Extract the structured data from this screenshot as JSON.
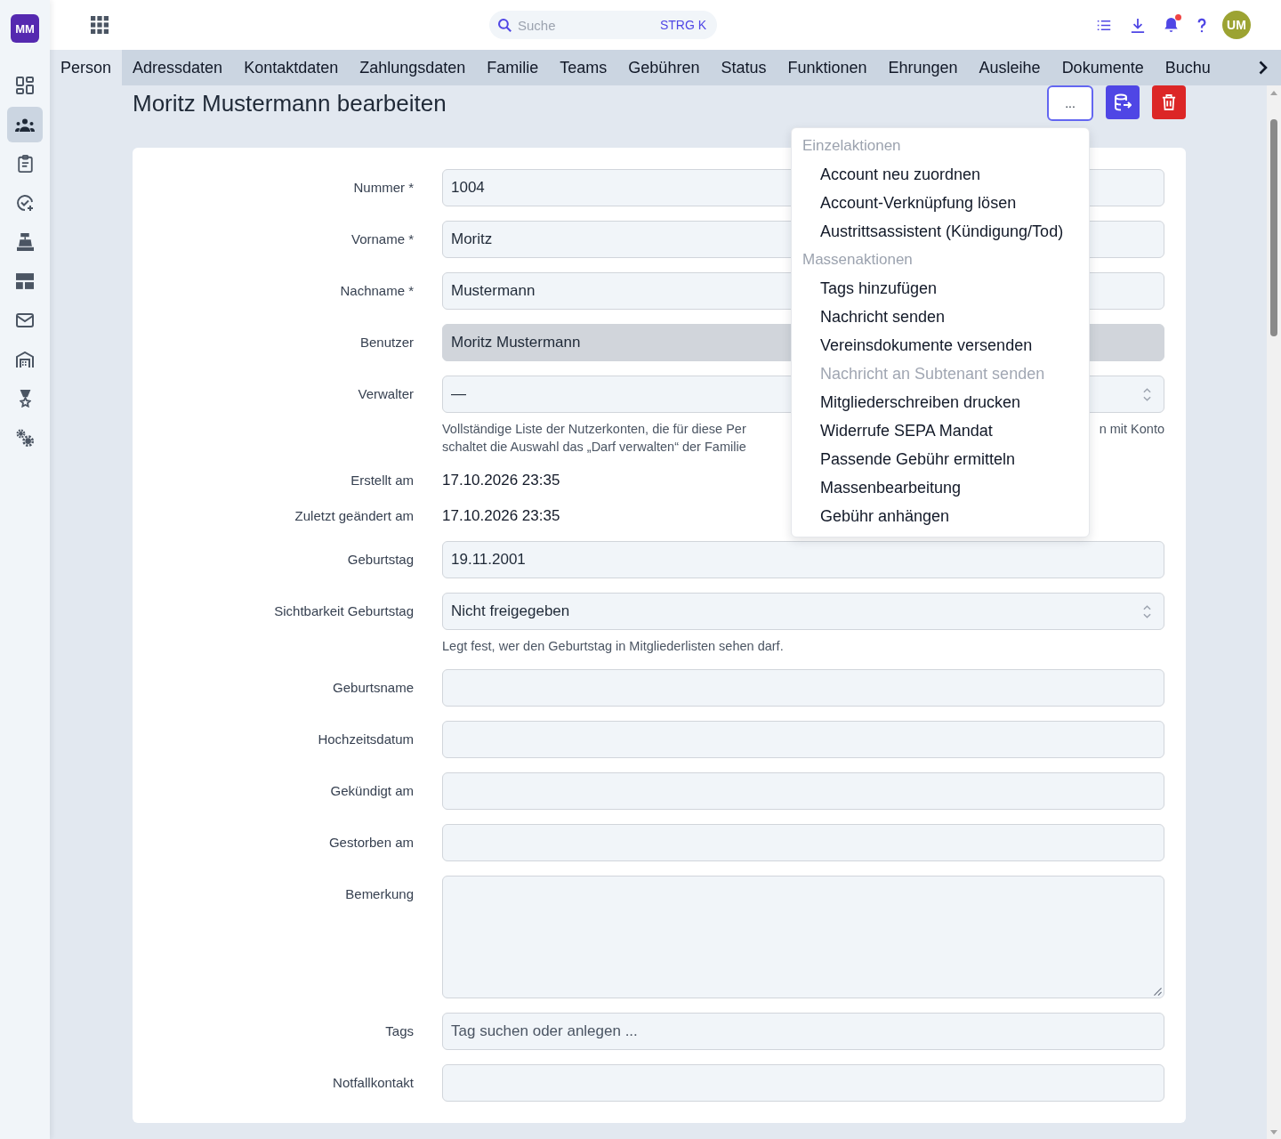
{
  "app": {
    "logo": "MM"
  },
  "sidebar": {
    "items": [
      {
        "selected": false
      },
      {
        "selected": true
      },
      {
        "selected": false
      },
      {
        "selected": false
      },
      {
        "selected": false
      },
      {
        "selected": false
      },
      {
        "selected": false
      },
      {
        "selected": false
      },
      {
        "selected": false
      },
      {
        "selected": false
      }
    ]
  },
  "header": {
    "search": {
      "placeholder": "Suche",
      "shortcut": "STRG K"
    },
    "notifications": {
      "unread": true
    },
    "avatar": {
      "initials": "UM"
    }
  },
  "tabs": [
    {
      "label": "Person",
      "selected": true
    },
    {
      "label": "Adressdaten",
      "selected": false
    },
    {
      "label": "Kontaktdaten",
      "selected": false
    },
    {
      "label": "Zahlungsdaten",
      "selected": false
    },
    {
      "label": "Familie",
      "selected": false
    },
    {
      "label": "Teams",
      "selected": false
    },
    {
      "label": "Gebühren",
      "selected": false
    },
    {
      "label": "Status",
      "selected": false
    },
    {
      "label": "Funktionen",
      "selected": false
    },
    {
      "label": "Ehrungen",
      "selected": false
    },
    {
      "label": "Ausleihe",
      "selected": false
    },
    {
      "label": "Dokumente",
      "selected": false
    },
    {
      "label": "Buchu",
      "selected": false
    }
  ],
  "page": {
    "title": "Moritz Mustermann bearbeiten",
    "more_button": "...",
    "menu": {
      "open": true,
      "sections": [
        {
          "title": "Einzelaktionen",
          "items": [
            {
              "label": "Account neu zuordnen",
              "disabled": false
            },
            {
              "label": "Account-Verknüpfung lösen",
              "disabled": false
            },
            {
              "label": "Austrittsassistent (Kündigung/Tod)",
              "disabled": false
            }
          ]
        },
        {
          "title": "Massenaktionen",
          "items": [
            {
              "label": "Tags hinzufügen",
              "disabled": false
            },
            {
              "label": "Nachricht senden",
              "disabled": false
            },
            {
              "label": "Vereinsdokumente versenden",
              "disabled": false
            },
            {
              "label": "Nachricht an Subtenant senden",
              "disabled": true
            },
            {
              "label": "Mitgliederschreiben drucken",
              "disabled": false
            },
            {
              "label": "Widerrufe SEPA Mandat",
              "disabled": false
            },
            {
              "label": "Passende Gebühr ermitteln",
              "disabled": false
            },
            {
              "label": "Massenbearbeitung",
              "disabled": false
            },
            {
              "label": "Gebühr anhängen",
              "disabled": false
            }
          ]
        }
      ]
    }
  },
  "form": {
    "fields": [
      {
        "label": "Nummer *",
        "kind": "input",
        "value": "1004",
        "disabled": false
      },
      {
        "label": "Vorname *",
        "kind": "input",
        "value": "Moritz",
        "disabled": false
      },
      {
        "label": "Nachname *",
        "kind": "input",
        "value": "Mustermann",
        "disabled": false
      },
      {
        "label": "Benutzer",
        "kind": "input",
        "value": "Moritz Mustermann",
        "disabled": true
      },
      {
        "label": "Verwalter",
        "kind": "select",
        "value": "—",
        "disabled": false,
        "help_lines": [
          {
            "left": "Vollständige Liste der Nutzerkonten, die für diese Per",
            "right": "n mit Konto"
          },
          {
            "left": "schaltet die Auswahl das „Darf verwalten“ der Familie"
          }
        ]
      },
      {
        "label": "Erstellt am",
        "kind": "static",
        "value": "17.10.2026 23:35",
        "disabled": false
      },
      {
        "label": "Zuletzt geändert am",
        "kind": "static",
        "value": "17.10.2026 23:35",
        "disabled": false
      },
      {
        "label": "Geburtstag",
        "kind": "input",
        "value": "19.11.2001",
        "disabled": false
      },
      {
        "label": "Sichtbarkeit Geburtstag",
        "kind": "select",
        "value": "Nicht freigegeben",
        "disabled": false,
        "help_lines": [
          {
            "left": "Legt fest, wer den Geburtstag in Mitgliederlisten sehen darf."
          }
        ]
      },
      {
        "label": "Geburtsname",
        "kind": "input",
        "disabled": false
      },
      {
        "label": "Hochzeitsdatum",
        "kind": "input",
        "disabled": false
      },
      {
        "label": "Gekündigt am",
        "kind": "input",
        "disabled": false
      },
      {
        "label": "Gestorben am",
        "kind": "input",
        "disabled": false
      },
      {
        "label": "Bemerkung",
        "kind": "textarea",
        "disabled": false
      },
      {
        "label": "Tags",
        "kind": "input",
        "placeholder": "Tag suchen oder anlegen ...",
        "disabled": false
      },
      {
        "label": "Notfallkontakt",
        "kind": "input",
        "disabled": false
      }
    ]
  }
}
